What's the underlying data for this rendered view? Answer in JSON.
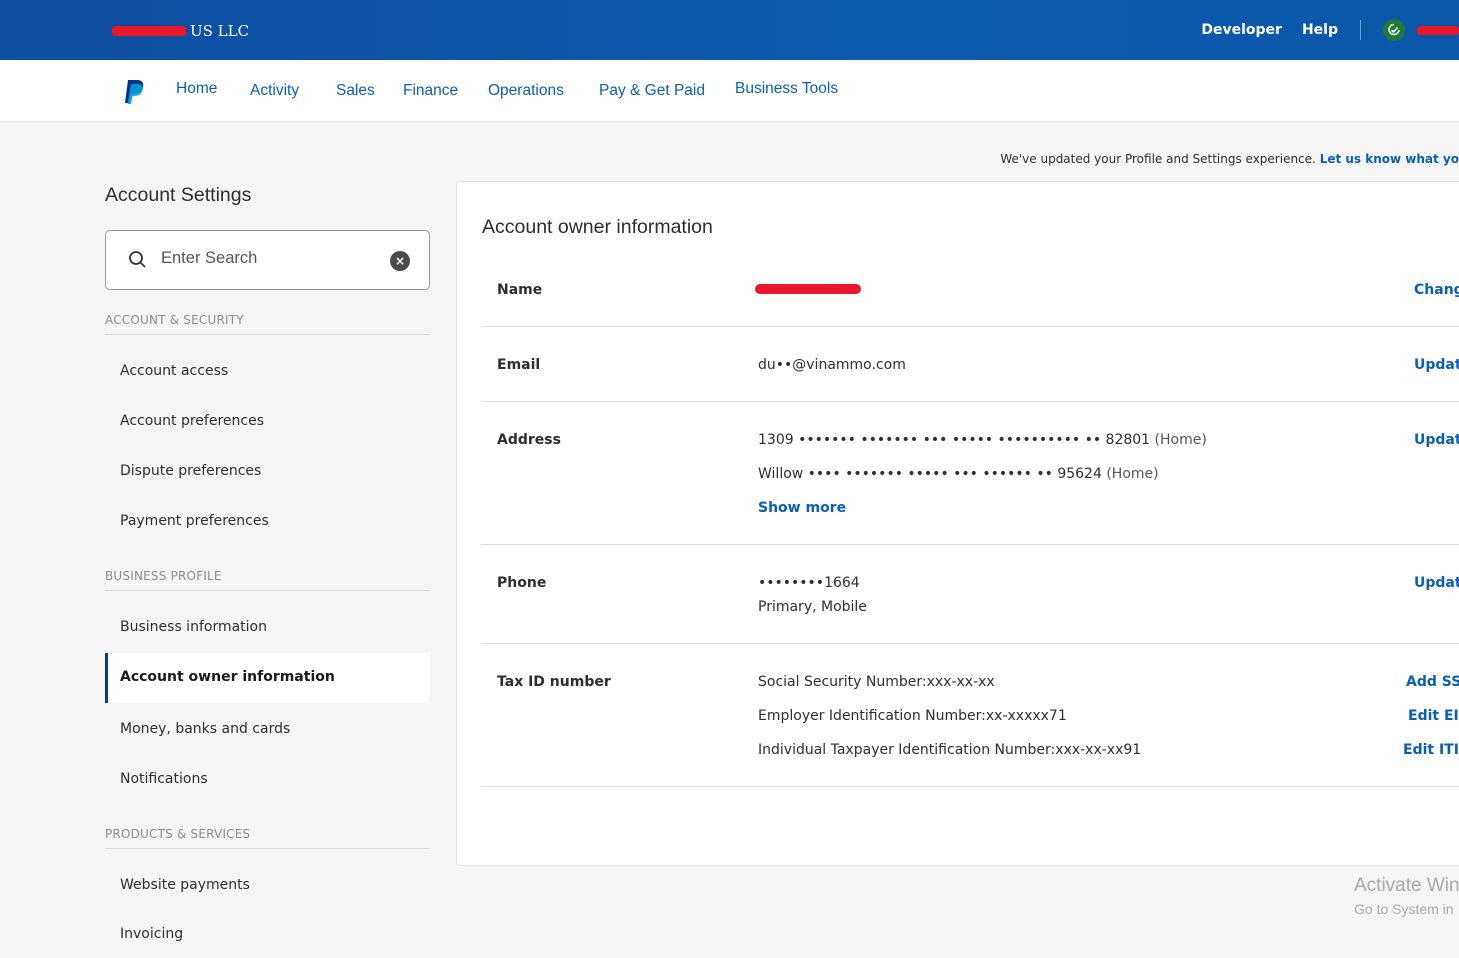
{
  "header": {
    "company_suffix": "US LLC",
    "developer": "Developer",
    "help": "Help"
  },
  "nav": {
    "items": [
      "Home",
      "Activity",
      "Sales",
      "Finance",
      "Operations",
      "Pay & Get Paid",
      "Business Tools"
    ]
  },
  "notice": {
    "text": "We've updated your Profile and Settings experience.",
    "link": "Let us know what yo"
  },
  "sidebar": {
    "title": "Account Settings",
    "search_placeholder": "Enter Search",
    "sections": [
      {
        "heading": "ACCOUNT & SECURITY",
        "items": [
          "Account access",
          "Account preferences",
          "Dispute preferences",
          "Payment preferences"
        ]
      },
      {
        "heading": "BUSINESS PROFILE",
        "items": [
          "Business information",
          "Account owner information",
          "Money, banks and cards",
          "Notifications"
        ]
      },
      {
        "heading": "PRODUCTS & SERVICES",
        "items": [
          "Website payments",
          "Invoicing"
        ]
      }
    ],
    "active_item": "Account owner information"
  },
  "main": {
    "title": "Account owner information",
    "name": {
      "label": "Name",
      "action": "Change"
    },
    "email": {
      "label": "Email",
      "value": "du••@vinammo.com",
      "action": "Update"
    },
    "address": {
      "label": "Address",
      "line1": "1309 ••••••• ••••••• ••• ••••• •••••••••• •• 82801",
      "line1_tag": "(Home)",
      "line2": "Willow •••• ••••••• ••••• ••• •••••• •• 95624",
      "line2_tag": "(Home)",
      "show_more": "Show more",
      "action": "Update"
    },
    "phone": {
      "label": "Phone",
      "value": "••••••••1664",
      "type": "Primary, Mobile",
      "action": "Update"
    },
    "tax": {
      "label": "Tax ID number",
      "ssn": "Social Security Number:xxx-xx-xx",
      "ein": "Employer Identification Number:xx-xxxxx71",
      "itin": "Individual Taxpayer Identification Number:xxx-xx-xx91",
      "ssn_action": "Add SSN",
      "ein_action": "Edit EIN",
      "itin_action": "Edit ITIN"
    }
  },
  "watermark": {
    "line1": "Activate Win",
    "line2": "Go to System in"
  }
}
